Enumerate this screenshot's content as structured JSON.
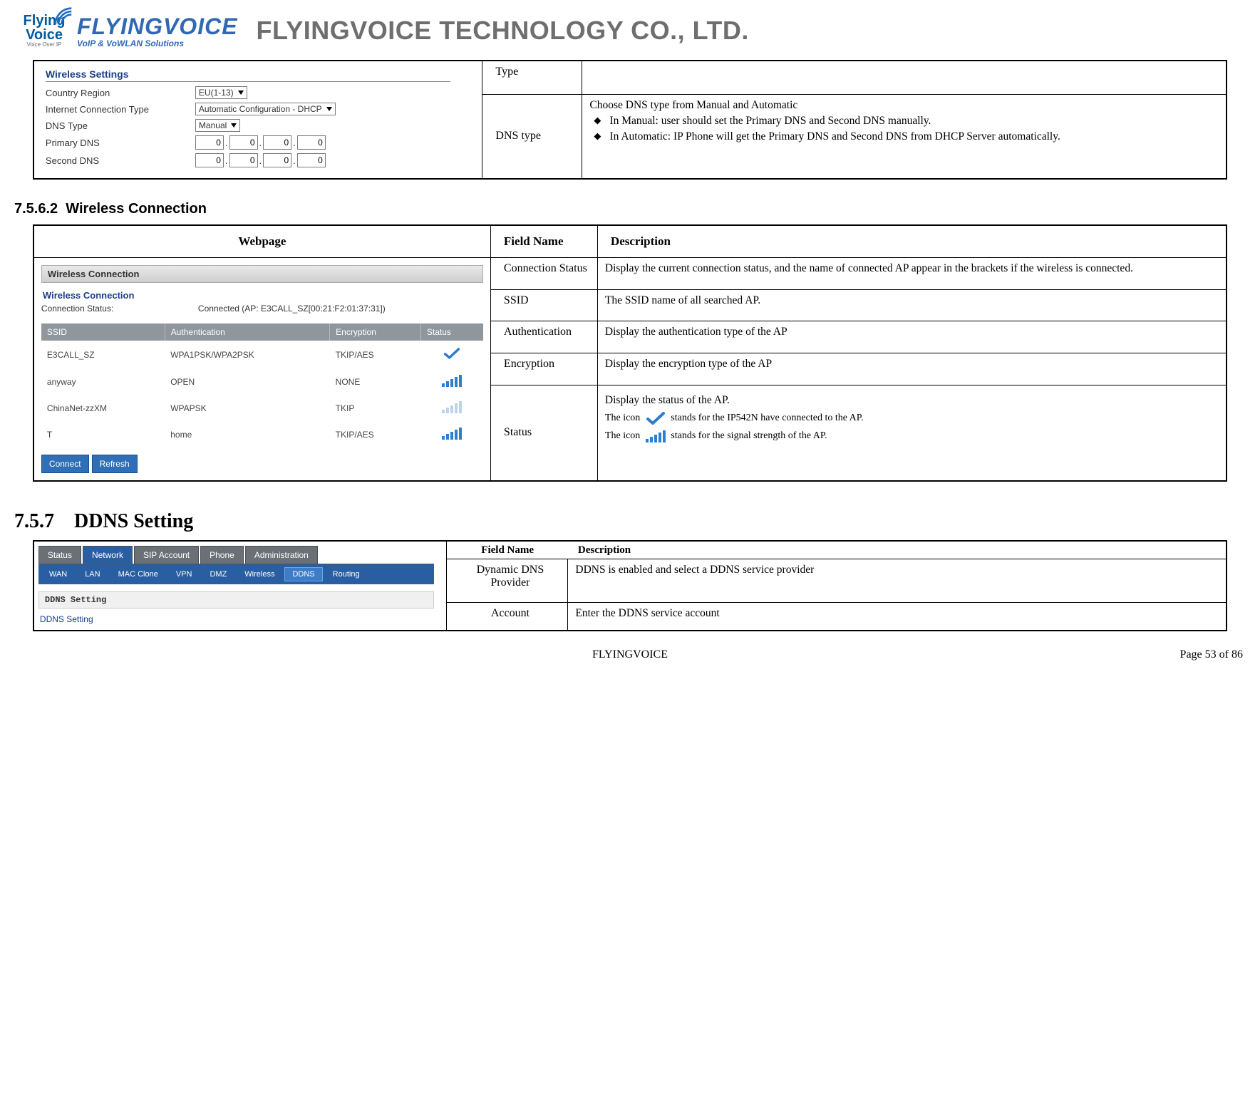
{
  "header": {
    "logo_line1": "Flying",
    "logo_line2": "Voice",
    "logo_sub": "Voice Over IP",
    "wordmark": "FLYINGVOICE",
    "wordmark_sub": "VoIP & VoWLAN Solutions",
    "company": "FLYINGVOICE TECHNOLOGY CO., LTD."
  },
  "table1": {
    "ws": {
      "heading": "Wireless Settings",
      "rows": {
        "country_region_label": "Country Region",
        "country_region_value": "EU(1-13)",
        "ict_label": "Internet Connection Type",
        "ict_value": "Automatic Configuration - DHCP",
        "dns_type_label": "DNS Type",
        "dns_type_value": "Manual",
        "primary_dns_label": "Primary DNS",
        "second_dns_label": "Second DNS",
        "ip_zero": "0"
      }
    },
    "rows": [
      {
        "field": "Type",
        "desc": ""
      },
      {
        "field": "DNS type",
        "desc_intro": "Choose DNS type from Manual and Automatic",
        "bullets": [
          "In Manual: user should set the Primary DNS and Second DNS manually.",
          "In Automatic: IP Phone will get the Primary DNS and Second DNS from DHCP Server automatically."
        ]
      }
    ]
  },
  "section2_heading_num": "7.5.6.2",
  "section2_heading": "Wireless Connection",
  "table2": {
    "headers": {
      "webpage": "Webpage",
      "field": "Field Name",
      "desc": "Description"
    },
    "wc": {
      "tab_label": "Wireless Connection",
      "sub_heading": "Wireless Connection",
      "status_label": "Connection Status:",
      "status_value": "Connected (AP: E3CALL_SZ[00:21:F2:01:37:31])",
      "grid_headers": {
        "ssid": "SSID",
        "auth": "Authentication",
        "enc": "Encryption",
        "status": "Status"
      },
      "rows": [
        {
          "ssid": "E3CALL_SZ",
          "auth": "WPA1PSK/WPA2PSK",
          "enc": "TKIP/AES",
          "status": "check"
        },
        {
          "ssid": "anyway",
          "auth": "OPEN",
          "enc": "NONE",
          "status": "signal"
        },
        {
          "ssid": "ChinaNet-zzXM",
          "auth": "WPAPSK",
          "enc": "TKIP",
          "status": "signal-dim"
        },
        {
          "ssid": "T",
          "auth": "home",
          "enc": "TKIP/AES",
          "status": "signal"
        }
      ],
      "buttons": {
        "connect": "Connect",
        "refresh": "Refresh"
      }
    },
    "rows": [
      {
        "field": "Connection Status",
        "desc": "Display the current connection status, and the name of connected AP appear in the brackets if the wireless is connected."
      },
      {
        "field": "SSID",
        "desc": "The SSID name of all searched AP."
      },
      {
        "field": "Authentication",
        "desc": "Display the authentication type of the AP"
      },
      {
        "field": "Encryption",
        "desc": "Display the encryption type of the AP"
      },
      {
        "field": "Status",
        "desc_p1": "Display the status of the AP.",
        "desc_p2a": "The icon",
        "desc_p2b": "stands for the IP542N have connected to the AP.",
        "desc_p3a": "The icon",
        "desc_p3b": "stands for the signal strength of the AP."
      }
    ]
  },
  "section3_heading_num": "7.5.7",
  "section3_heading": "DDNS Setting",
  "table3": {
    "headers": {
      "field": "Field Name",
      "desc": "Description"
    },
    "ddns": {
      "tabs1": [
        "Status",
        "Network",
        "SIP Account",
        "Phone",
        "Administration"
      ],
      "tabs1_active": "Network",
      "tabs2": [
        "WAN",
        "LAN",
        "MAC Clone",
        "VPN",
        "DMZ",
        "Wireless",
        "DDNS",
        "Routing"
      ],
      "tabs2_active": "DDNS",
      "panel_heading": "DDNS Setting",
      "sub_heading": "DDNS Setting"
    },
    "rows": [
      {
        "field": "Dynamic DNS Provider",
        "desc": "DDNS is enabled and select a DDNS service provider"
      },
      {
        "field": "Account",
        "desc": "Enter the DDNS service account"
      }
    ]
  },
  "footer": {
    "center": "FLYINGVOICE",
    "right": "Page 53 of 86"
  }
}
